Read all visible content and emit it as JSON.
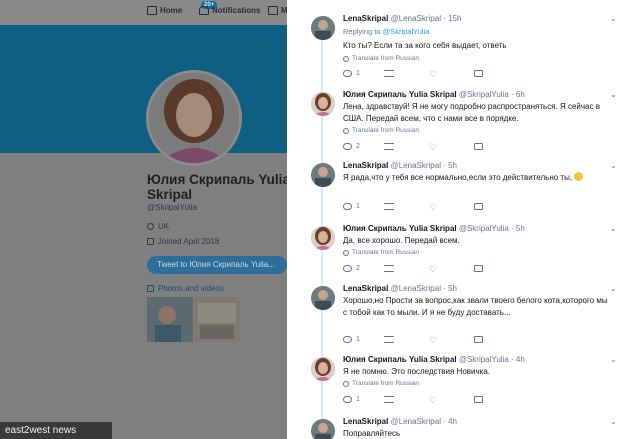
{
  "nav": {
    "home": "Home",
    "notifications": "Notifications",
    "badge": "20+",
    "messages": "M"
  },
  "profile": {
    "name": "Юлия Скрипаль Yulia Skripal",
    "handle": "@SkripalYulia",
    "location": "UK",
    "joined": "Joined April 2018",
    "tweet_to": "Tweet to Юлия Скрипаль Yulia...",
    "photos": "Photos and videos"
  },
  "watermark": "east2west news",
  "tweets": [
    {
      "name": "LenaSkripal",
      "handle": "@LenaSkripal",
      "time": "· 15h",
      "reply_prefix": "Replying to ",
      "reply_to": "@SkripalYulia",
      "text": "Кто ты? Если та за кого себя выдает, ответь",
      "translate": "Translate from Russian",
      "replies": "1"
    },
    {
      "name": "Юлия Скрипаль Yulia Skripal",
      "handle": "@SkripalYulia",
      "time": "· 6h",
      "text": "Лена, здравствуй! Я не могу подробно распространяться. Я сейчас в США. Передай всем, что с нами все в порядке.",
      "translate": "Translate from Russian",
      "replies": "2"
    },
    {
      "name": "LenaSkripal",
      "handle": "@LenaSkripal",
      "time": "· 5h",
      "text": "Я рада,что у тебя все нормально,если это действительно ты,",
      "replies": "1"
    },
    {
      "name": "Юлия Скрипаль Yulia Skripal",
      "handle": "@SkripalYulia",
      "time": "· 5h",
      "text": "Да, все хорошо. Передай всем.",
      "translate": "Translate from Russian",
      "replies": "2"
    },
    {
      "name": "LenaSkripal",
      "handle": "@LenaSkripal",
      "time": "· 5h",
      "text": "Хорошо,но Прости за вопрос,как звали твоего белого кота,которого мы с тобой как то мыли. И я не буду доставать...",
      "replies": "1"
    },
    {
      "name": "Юлия Скрипаль Yulia Skripal",
      "handle": "@SkripalYulia",
      "time": "· 4h",
      "text": "Я не помню. Это последствия Новичка.",
      "translate": "Translate from Russian",
      "replies": "1"
    },
    {
      "name": "LenaSkripal",
      "handle": "@LenaSkripal",
      "time": "· 4h",
      "text": "Поправляйтесь"
    }
  ]
}
